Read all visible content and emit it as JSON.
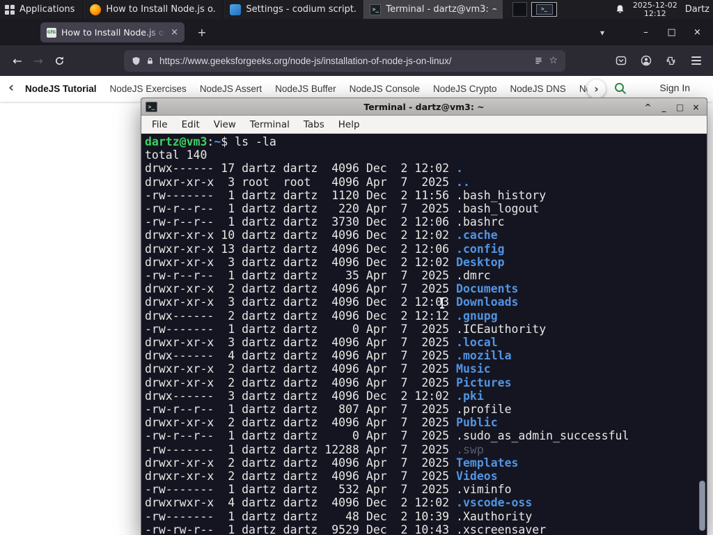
{
  "colors": {
    "gfg_green": "#2f8d46",
    "directory_blue": "#5294e2",
    "prompt_green": "#3ed160",
    "firefox_orange": "#ff9400"
  },
  "icons": {
    "close": "×",
    "minimize": "–",
    "maximize": "□",
    "shade": "^",
    "underscore_min": "_",
    "plus": "+",
    "back": "←",
    "forward": "→",
    "star": "☆",
    "chevron_down": "▾",
    "chevron_left": "‹",
    "chevron_right": "›",
    "terminal_glyph": ">_",
    "favicon_text": "GfG"
  },
  "panel": {
    "applications_label": "Applications",
    "taskbar": [
      {
        "title": "How to Install Node.js o...",
        "icon": "firefox",
        "active": false
      },
      {
        "title": "Settings - codium script...",
        "icon": "codium",
        "active": false
      },
      {
        "title": "Terminal - dartz@vm3: ~",
        "icon": "terminal",
        "active": true
      }
    ],
    "clock": {
      "date": "2025-12-02",
      "time": "12:12"
    },
    "user": "Dartz"
  },
  "browser": {
    "tab": {
      "title": "How to Install Node.js on..."
    },
    "url": "https://www.geeksforgeeks.org/node-js/installation-of-node-js-on-linux/",
    "nav": {
      "items": [
        "NodeJS Tutorial",
        "NodeJS Exercises",
        "NodeJS Assert",
        "NodeJS Buffer",
        "NodeJS Console",
        "NodeJS Crypto",
        "NodeJS DNS",
        "NodeJS"
      ],
      "sign_in": "Sign In"
    }
  },
  "terminal": {
    "title": "Terminal - dartz@vm3: ~",
    "menus": [
      "File",
      "Edit",
      "View",
      "Terminal",
      "Tabs",
      "Help"
    ],
    "prompt": {
      "user": "dartz@vm3",
      "colon": ":",
      "path": "~",
      "dollar": "$ ",
      "command": "ls -la"
    },
    "total": "total 140",
    "listing": [
      {
        "meta": "drwx------ 17 dartz dartz  4096 Dec  2 12:02 ",
        "name": ".",
        "type": "dir"
      },
      {
        "meta": "drwxr-xr-x  3 root  root   4096 Apr  7  2025 ",
        "name": "..",
        "type": "dir"
      },
      {
        "meta": "-rw-------  1 dartz dartz  1120 Dec  2 11:56 ",
        "name": ".bash_history",
        "type": "file"
      },
      {
        "meta": "-rw-r--r--  1 dartz dartz   220 Apr  7  2025 ",
        "name": ".bash_logout",
        "type": "file"
      },
      {
        "meta": "-rw-r--r--  1 dartz dartz  3730 Dec  2 12:06 ",
        "name": ".bashrc",
        "type": "file"
      },
      {
        "meta": "drwxr-xr-x 10 dartz dartz  4096 Dec  2 12:02 ",
        "name": ".cache",
        "type": "dir"
      },
      {
        "meta": "drwxr-xr-x 13 dartz dartz  4096 Dec  2 12:06 ",
        "name": ".config",
        "type": "dir"
      },
      {
        "meta": "drwxr-xr-x  3 dartz dartz  4096 Dec  2 12:02 ",
        "name": "Desktop",
        "type": "dir"
      },
      {
        "meta": "-rw-r--r--  1 dartz dartz    35 Apr  7  2025 ",
        "name": ".dmrc",
        "type": "file"
      },
      {
        "meta": "drwxr-xr-x  2 dartz dartz  4096 Apr  7  2025 ",
        "name": "Documents",
        "type": "dir"
      },
      {
        "meta": "drwxr-xr-x  3 dartz dartz  4096 Dec  2 12:03 ",
        "name": "Downloads",
        "type": "dir"
      },
      {
        "meta": "drwx------  2 dartz dartz  4096 Dec  2 12:12 ",
        "name": ".gnupg",
        "type": "dir"
      },
      {
        "meta": "-rw-------  1 dartz dartz     0 Apr  7  2025 ",
        "name": ".ICEauthority",
        "type": "file"
      },
      {
        "meta": "drwxr-xr-x  3 dartz dartz  4096 Apr  7  2025 ",
        "name": ".local",
        "type": "dir"
      },
      {
        "meta": "drwx------  4 dartz dartz  4096 Apr  7  2025 ",
        "name": ".mozilla",
        "type": "dir"
      },
      {
        "meta": "drwxr-xr-x  2 dartz dartz  4096 Apr  7  2025 ",
        "name": "Music",
        "type": "dir"
      },
      {
        "meta": "drwxr-xr-x  2 dartz dartz  4096 Apr  7  2025 ",
        "name": "Pictures",
        "type": "dir"
      },
      {
        "meta": "drwx------  3 dartz dartz  4096 Dec  2 12:02 ",
        "name": ".pki",
        "type": "dir"
      },
      {
        "meta": "-rw-r--r--  1 dartz dartz   807 Apr  7  2025 ",
        "name": ".profile",
        "type": "file"
      },
      {
        "meta": "drwxr-xr-x  2 dartz dartz  4096 Apr  7  2025 ",
        "name": "Public",
        "type": "dir"
      },
      {
        "meta": "-rw-r--r--  1 dartz dartz     0 Apr  7  2025 ",
        "name": ".sudo_as_admin_successful",
        "type": "file"
      },
      {
        "meta": "-rw-------  1 dartz dartz 12288 Apr  7  2025 ",
        "name": ".swp",
        "type": "dim"
      },
      {
        "meta": "drwxr-xr-x  2 dartz dartz  4096 Apr  7  2025 ",
        "name": "Templates",
        "type": "dir"
      },
      {
        "meta": "drwxr-xr-x  2 dartz dartz  4096 Apr  7  2025 ",
        "name": "Videos",
        "type": "dir"
      },
      {
        "meta": "-rw-------  1 dartz dartz   532 Apr  7  2025 ",
        "name": ".viminfo",
        "type": "file"
      },
      {
        "meta": "drwxrwxr-x  4 dartz dartz  4096 Dec  2 12:02 ",
        "name": ".vscode-oss",
        "type": "dir"
      },
      {
        "meta": "-rw-------  1 dartz dartz    48 Dec  2 10:39 ",
        "name": ".Xauthority",
        "type": "file"
      },
      {
        "meta": "-rw-rw-r--  1 dartz dartz  9529 Dec  2 10:43 ",
        "name": ".xscreensaver",
        "type": "file"
      }
    ]
  }
}
